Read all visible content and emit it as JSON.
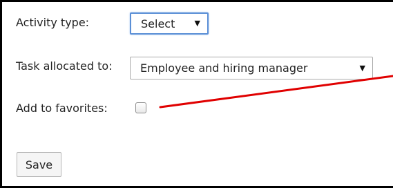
{
  "form": {
    "activity_type_label": "Activity type:",
    "activity_type_value": "Select",
    "task_allocated_label": "Task allocated to:",
    "task_allocated_value": "Employee and hiring manager",
    "favorites_label": "Add to favorites:",
    "favorites_checked": false,
    "save_label": "Save"
  },
  "icons": {
    "caret": "▼"
  },
  "colors": {
    "annotation_line": "#e00000",
    "focus_border": "#5b8fd6"
  }
}
